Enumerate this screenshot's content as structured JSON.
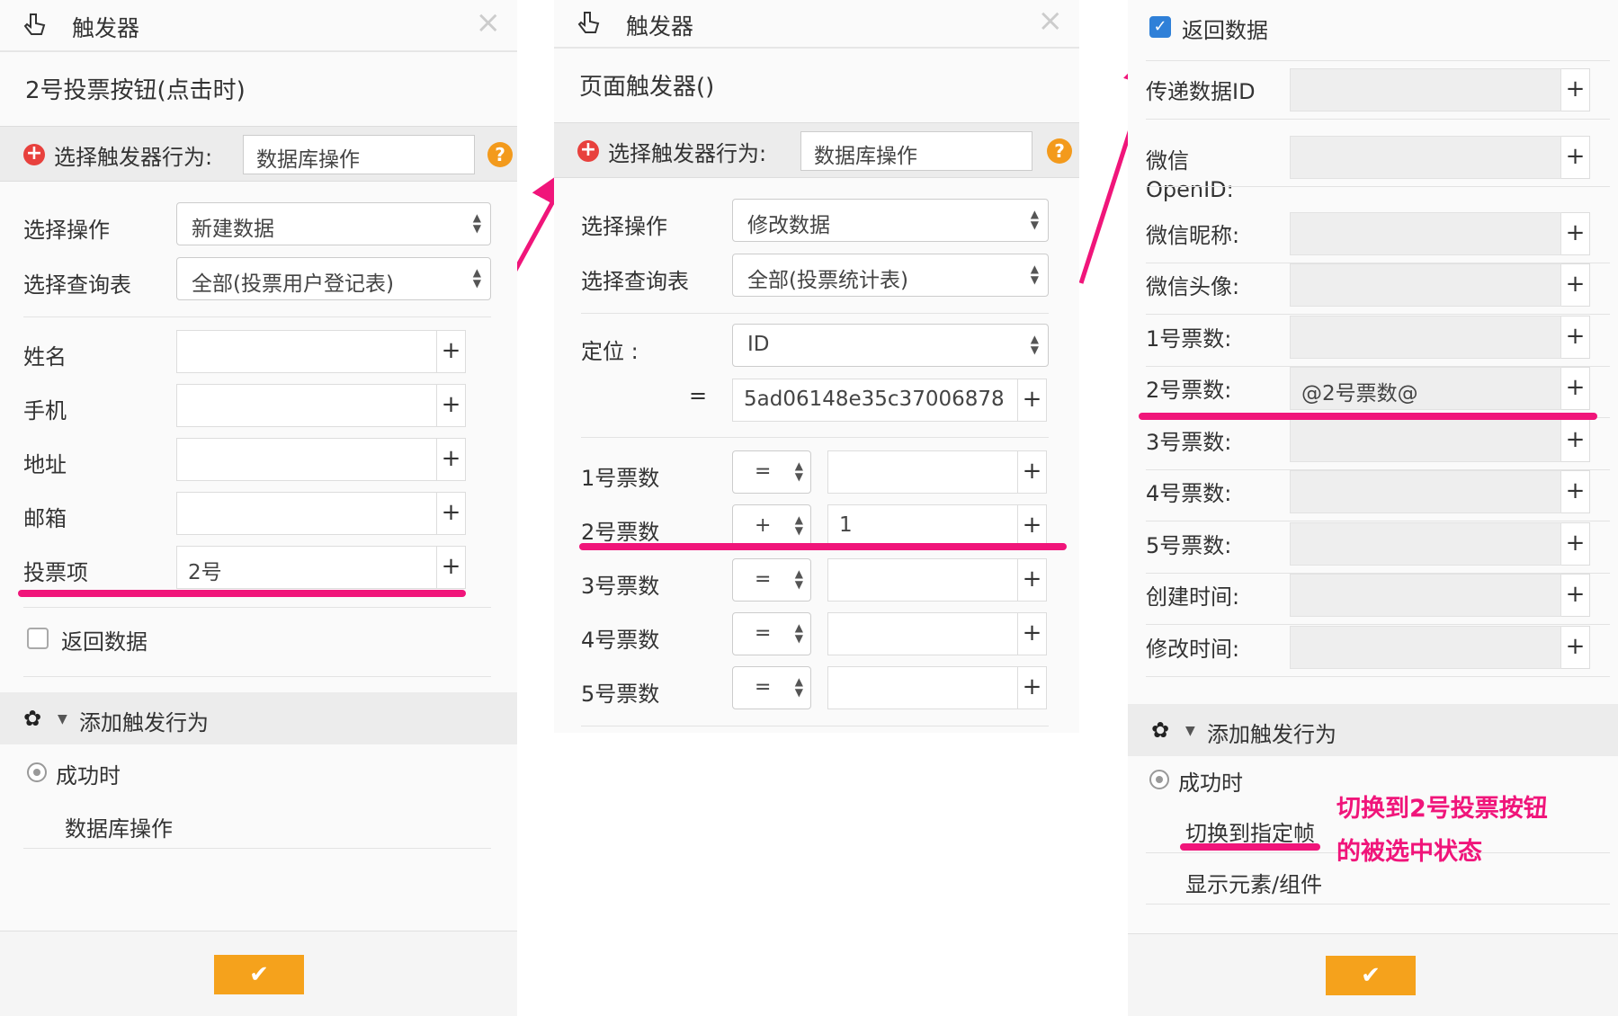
{
  "p1": {
    "title": "触发器",
    "subtitle": "2号投票按钮(点击时)",
    "behavior_label": "选择触发器行为:",
    "behavior_value": "数据库操作",
    "help": "?",
    "op_label": "选择操作",
    "op_value": "新建数据",
    "table_label": "选择查询表",
    "table_value": "全部(投票用户登记表)",
    "fields": [
      {
        "label": "姓名",
        "value": ""
      },
      {
        "label": "手机",
        "value": ""
      },
      {
        "label": "地址",
        "value": ""
      },
      {
        "label": "邮箱",
        "value": ""
      },
      {
        "label": "投票项",
        "value": "2号"
      }
    ],
    "return_label": "返回数据",
    "add_label": "添加触发行为",
    "success_label": "成功时",
    "action_item": "数据库操作",
    "ok": "✔"
  },
  "p2": {
    "title": "触发器",
    "subtitle": "页面触发器()",
    "behavior_label": "选择触发器行为:",
    "behavior_value": "数据库操作",
    "help": "?",
    "op_label": "选择操作",
    "op_value": "修改数据",
    "table_label": "选择查询表",
    "table_value": "全部(投票统计表)",
    "locate_label": "定位 :",
    "locate_value": "ID",
    "eq": "=",
    "id_value": "5ad06148e35c37006878",
    "votes": [
      {
        "label": "1号票数",
        "op": "=",
        "value": ""
      },
      {
        "label": "2号票数",
        "op": "+",
        "value": "1"
      },
      {
        "label": "3号票数",
        "op": "=",
        "value": ""
      },
      {
        "label": "4号票数",
        "op": "=",
        "value": ""
      },
      {
        "label": "5号票数",
        "op": "=",
        "value": ""
      }
    ]
  },
  "p3": {
    "return_label": "返回数据",
    "fields": [
      {
        "label": "传递数据ID",
        "value": ""
      },
      {
        "label": "微信\nOpenID:",
        "value": ""
      },
      {
        "label": "微信昵称:",
        "value": ""
      },
      {
        "label": "微信头像:",
        "value": ""
      },
      {
        "label": "1号票数:",
        "value": ""
      },
      {
        "label": "2号票数:",
        "value": "@2号票数@"
      },
      {
        "label": "3号票数:",
        "value": ""
      },
      {
        "label": "4号票数:",
        "value": ""
      },
      {
        "label": "5号票数:",
        "value": ""
      },
      {
        "label": "创建时间:",
        "value": ""
      },
      {
        "label": "修改时间:",
        "value": ""
      }
    ],
    "add_label": "添加触发行为",
    "success_label": "成功时",
    "action_items": [
      "切换到指定帧",
      "显示元素/组件"
    ],
    "annotation_line1": "切换到2号投票按钮",
    "annotation_line2": "的被选中状态",
    "ok": "✔"
  },
  "plus": "+",
  "close": "×",
  "gear": "✿",
  "colors": {
    "accent": "#f5a21c",
    "highlight": "#f0157a",
    "error": "#e8413d",
    "checkbox": "#2f80d8"
  }
}
